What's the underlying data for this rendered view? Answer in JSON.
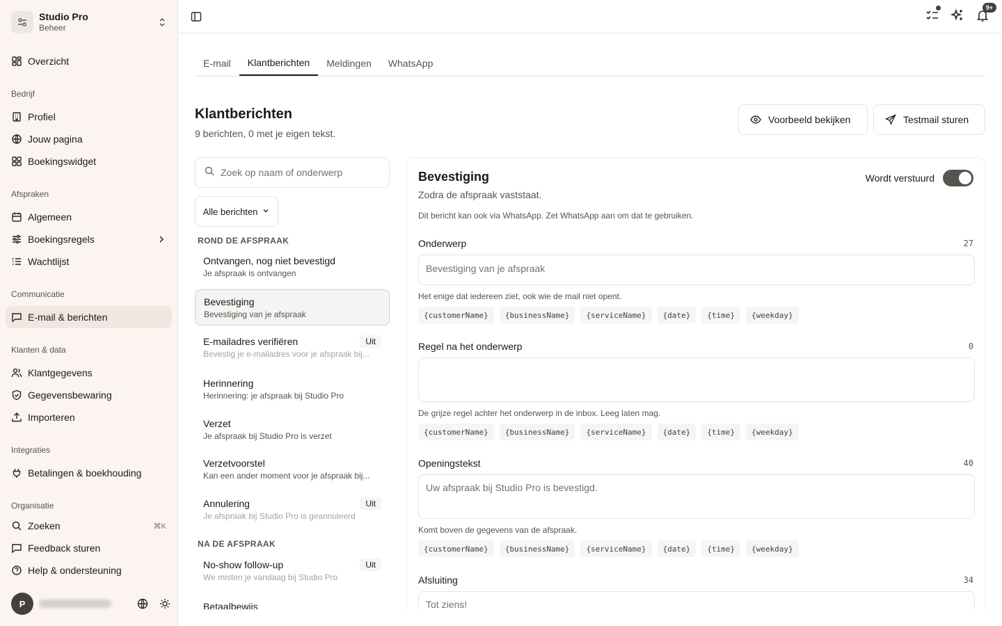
{
  "workspace": {
    "name": "Studio Pro",
    "subtitle": "Beheer"
  },
  "nav": {
    "overview": "Overzicht",
    "sections": {
      "bedrijf": "Bedrijf",
      "afspraken": "Afspraken",
      "communicatie": "Communicatie",
      "klanten": "Klanten & data",
      "integraties": "Integraties",
      "organisatie": "Organisatie"
    },
    "items": {
      "profiel": "Profiel",
      "jouw_pagina": "Jouw pagina",
      "boekingswidget": "Boekingswidget",
      "algemeen": "Algemeen",
      "boekingsregels": "Boekingsregels",
      "wachtlijst": "Wachtlijst",
      "email": "E-mail & berichten",
      "klantgegevens": "Klantgegevens",
      "gegevensbewaring": "Gegevensbewaring",
      "importeren": "Importeren",
      "betalingen": "Betalingen & boekhouding",
      "zoeken": "Zoeken",
      "zoeken_shortcut": "⌘K",
      "feedback": "Feedback sturen",
      "help": "Help & ondersteuning"
    },
    "user_initial": "P"
  },
  "topbar": {
    "notifications_badge": "9+"
  },
  "tabs": [
    "E-mail",
    "Klantberichten",
    "Meldingen",
    "WhatsApp"
  ],
  "page": {
    "title": "Klantberichten",
    "subtitle": "9 berichten, 0 met je eigen tekst.",
    "preview_button": "Voorbeeld bekijken",
    "testmail_button": "Testmail sturen"
  },
  "search": {
    "placeholder": "Zoek op naam of onderwerp"
  },
  "filter": {
    "label": "Alle berichten"
  },
  "groups": {
    "rond": "ROND DE AFSPRAAK",
    "na": "NA DE AFSPRAAK"
  },
  "messages": [
    {
      "title": "Ontvangen, nog niet bevestigd",
      "subject": "Je afspraak is ontvangen",
      "badge": ""
    },
    {
      "title": "Bevestiging",
      "subject": "Bevestiging van je afspraak",
      "badge": ""
    },
    {
      "title": "E-mailadres verifiëren",
      "subject": "Bevestig je e-mailadres voor je afspraak bij...",
      "badge": "Uit"
    },
    {
      "title": "Herinnering",
      "subject": "Herinnering: je afspraak bij Studio Pro",
      "badge": ""
    },
    {
      "title": "Verzet",
      "subject": "Je afspraak bij Studio Pro is verzet",
      "badge": ""
    },
    {
      "title": "Verzetvoorstel",
      "subject": "Kan een ander moment voor je afspraak bij...",
      "badge": ""
    },
    {
      "title": "Annulering",
      "subject": "Je afspraak bij Studio Pro is geannuleerd",
      "badge": "Uit"
    },
    {
      "title": "No-show follow-up",
      "subject": "We misten je vandaag bij Studio Pro",
      "badge": "Uit"
    },
    {
      "title": "Betaalbewijs",
      "subject": "",
      "badge": ""
    }
  ],
  "editor": {
    "title": "Bevestiging",
    "subtitle": "Zodra de afspraak vaststaat.",
    "note": "Dit bericht kan ook via WhatsApp. Zet WhatsApp aan om dat te gebruiken.",
    "toggle_label": "Wordt verstuurd",
    "toggle_on": true,
    "variables": [
      "{customerName}",
      "{businessName}",
      "{serviceName}",
      "{date}",
      "{time}",
      "{weekday}"
    ],
    "fields": [
      {
        "label": "Onderwerp",
        "count": "27",
        "value": "Bevestiging van je afspraak",
        "help": "Het enige dat iedereen ziet, ook wie de mail niet opent."
      },
      {
        "label": "Regel na het onderwerp",
        "count": "0",
        "value": "",
        "help": "De grijze regel achter het onderwerp in de inbox. Leeg laten mag."
      },
      {
        "label": "Openingstekst",
        "count": "40",
        "value": "Uw afspraak bij Studio Pro is bevestigd.",
        "help": "Komt boven de gegevens van de afspraak."
      },
      {
        "label": "Afsluiting",
        "count": "34",
        "value": "Tot ziens!",
        "help": ""
      }
    ]
  }
}
